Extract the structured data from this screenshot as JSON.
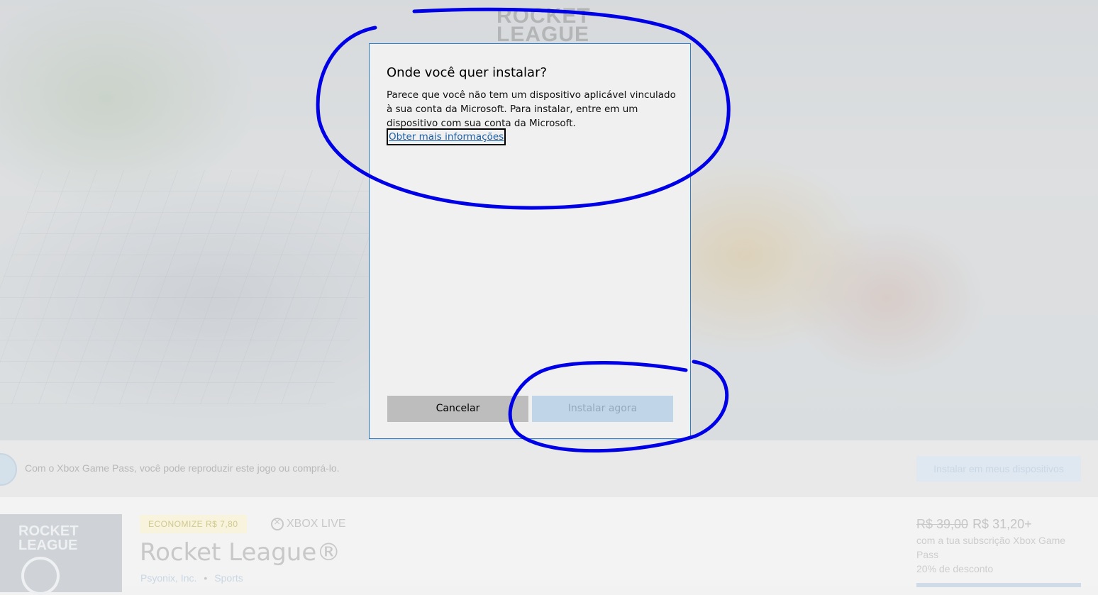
{
  "background": {
    "hero_logo": "ROCKET\nLEAGUE"
  },
  "dialog": {
    "title": "Onde você quer instalar?",
    "body": "Parece que você não tem um dispositivo aplicável vinculado à sua conta da Microsoft. Para instalar, entre em um dispositivo com sua conta da Microsoft.",
    "link": "Obter mais informações",
    "cancel_label": "Cancelar",
    "install_label": "Instalar agora",
    "install_enabled": false,
    "border_color": "#2b7cd3"
  },
  "game_pass_bar": {
    "message": "Com o Xbox Game Pass, você pode reproduzir este jogo ou comprá-lo.",
    "button_label": "Instalar em meus dispositivos"
  },
  "product": {
    "thumbnail_logo": "ROCKET\nLEAGUE",
    "save_badge": "ECONOMIZE R$ 7,80",
    "xbox_live": "XBOX LIVE",
    "title": "Rocket League®",
    "publisher": "Psyonix, Inc.",
    "separator": "•",
    "category": "Sports",
    "old_price": "R$ 39,00",
    "new_price": "R$ 31,20+",
    "subscription_text": "com a tua subscrição Xbox Game Pass",
    "discount_text": "20% de desconto"
  },
  "annotation": {
    "color": "#0000e6"
  }
}
